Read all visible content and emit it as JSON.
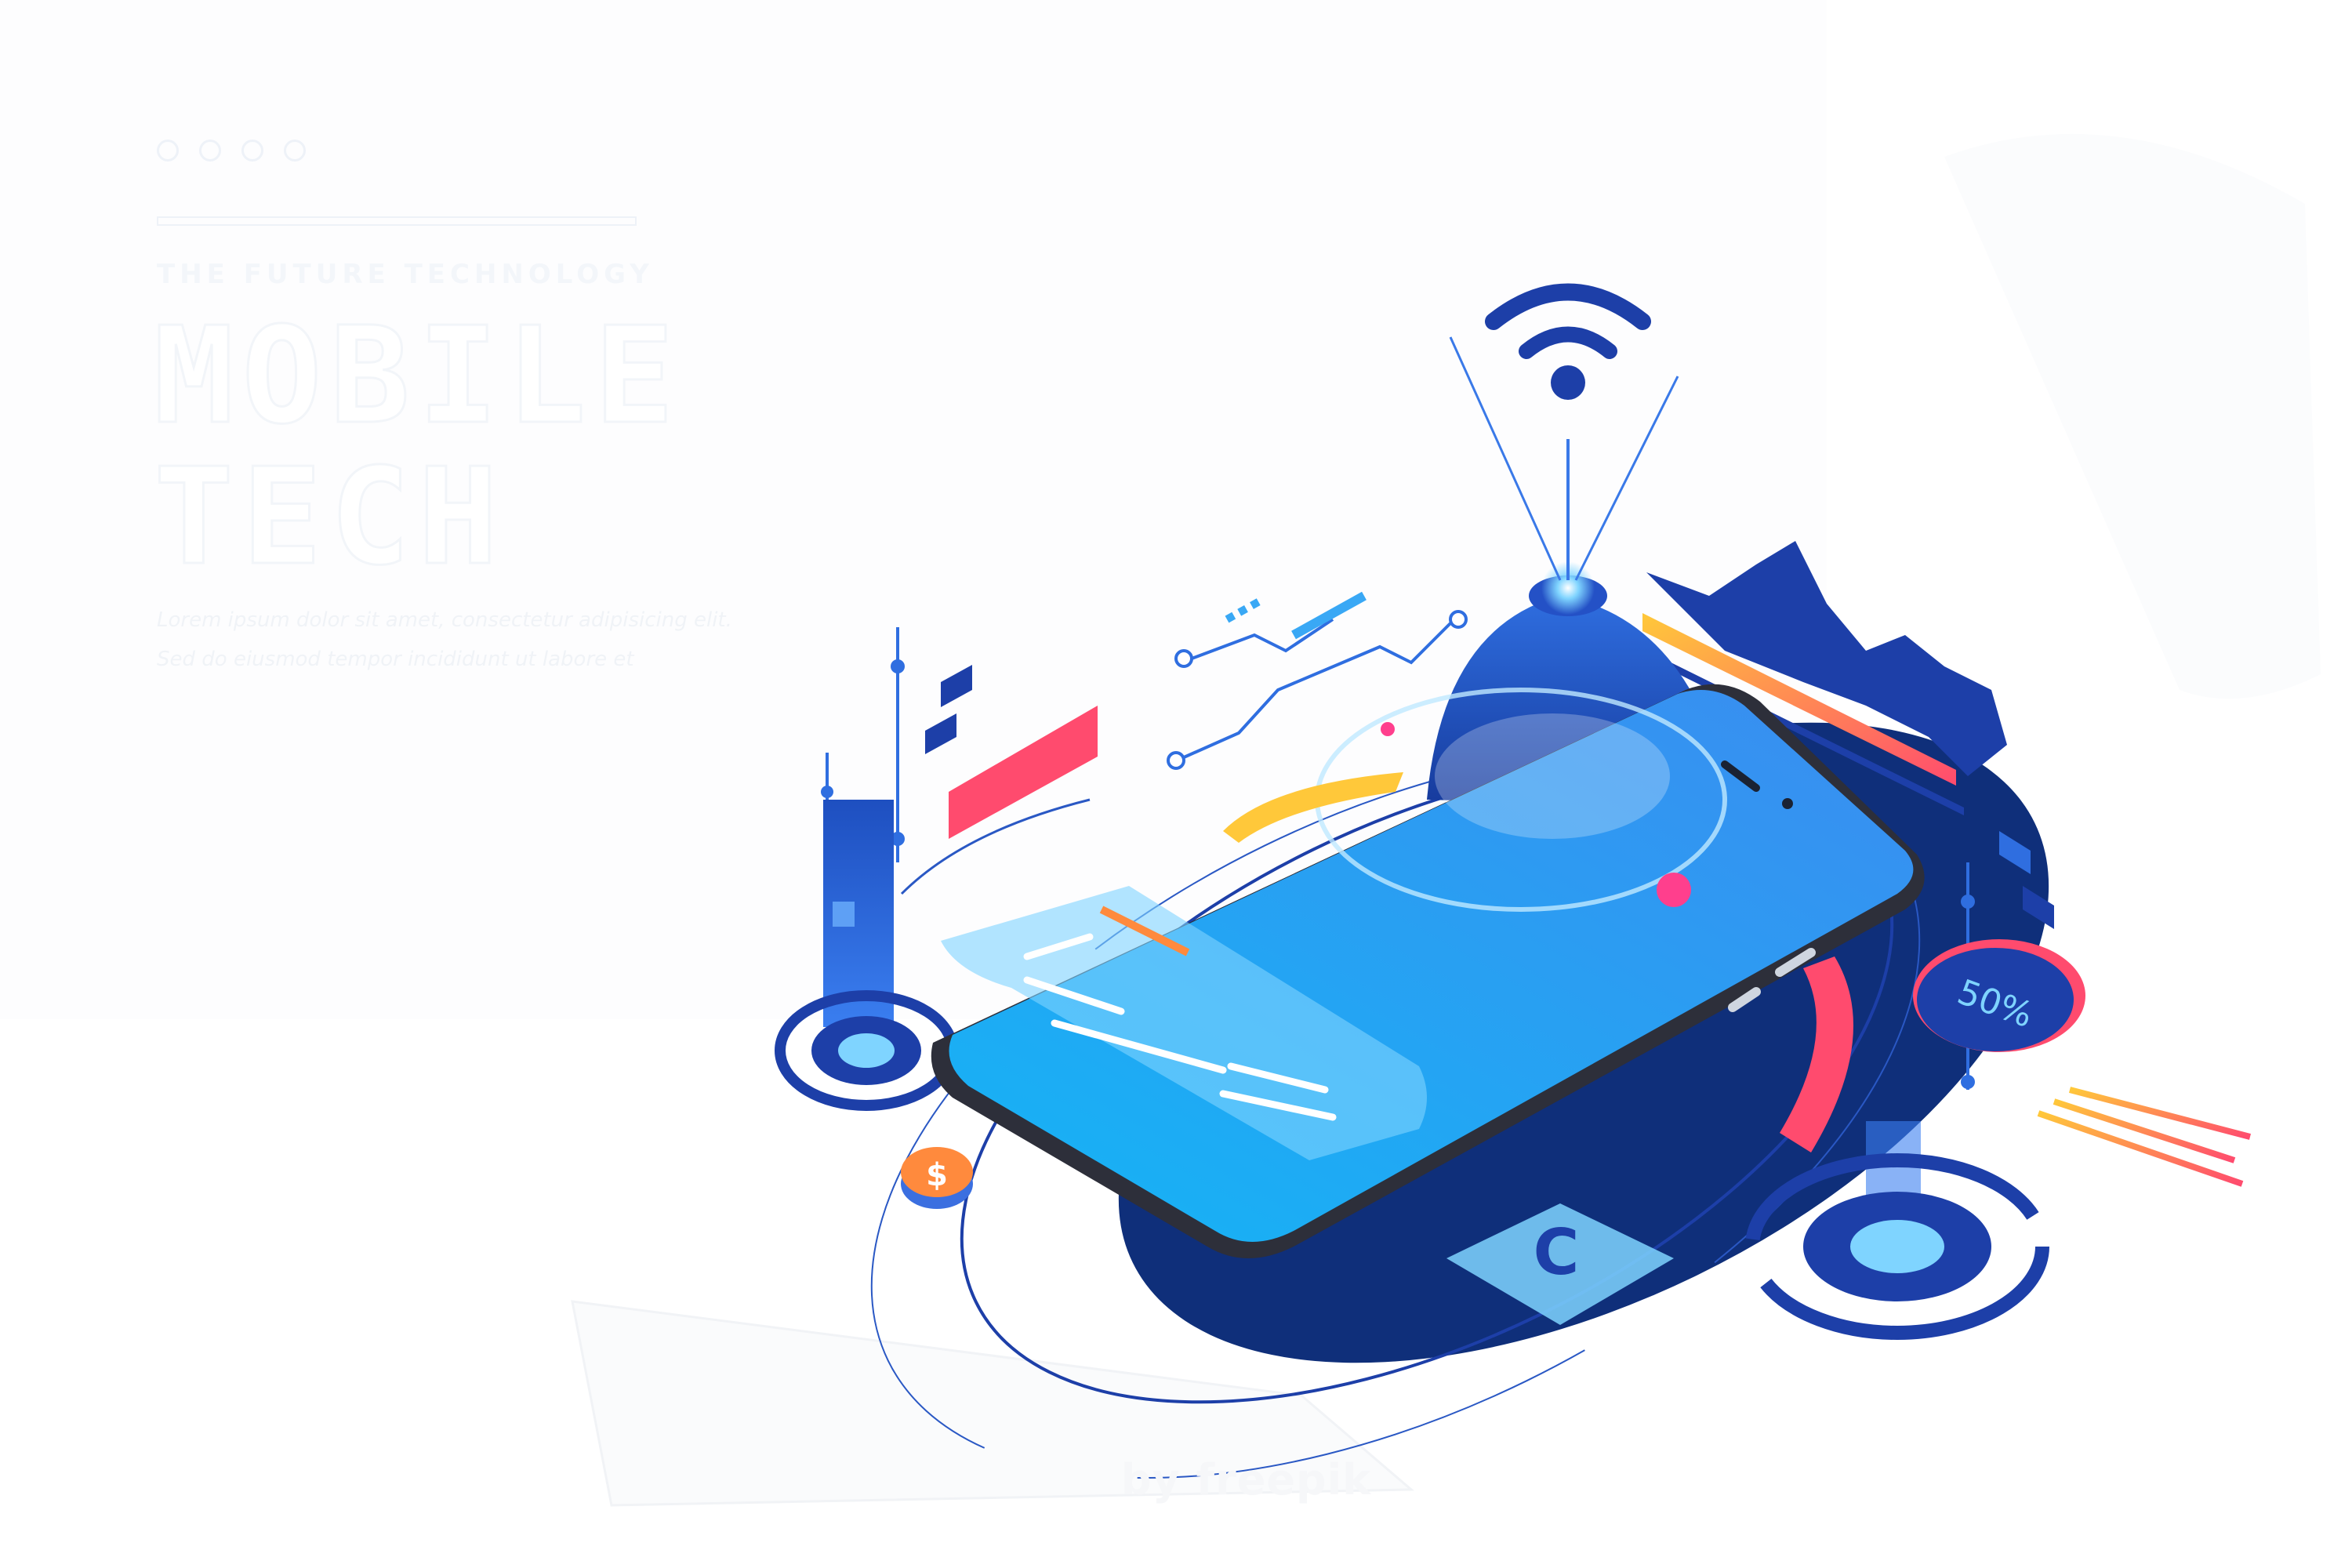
{
  "header": {
    "eyebrow": "THE FUTURE TECHNOLOGY",
    "title_line1": "MOBILE",
    "title_line2": "TECH",
    "body_line1": "Lorem ipsum dolor sit amet, consectetur adipisicing elit.",
    "body_line2": "Sed do eiusmod tempor incididunt ut labore et"
  },
  "illustration": {
    "badge_percent": "50%",
    "currency_symbol": "$",
    "phone_symbol": "C",
    "colors": {
      "primary_blue": "#1d3fa8",
      "deep_navy": "#0f2f7a",
      "screen_blue": "#22a4f0",
      "accent_red": "#ff4b6e",
      "accent_orange": "#ff8a3d",
      "accent_yellow": "#ffc83a",
      "accent_pink": "#ff3f8d"
    },
    "icons": [
      "wifi-icon",
      "circuit-icon",
      "dollar-coin-icon",
      "phone-call-icon",
      "percent-badge-icon",
      "mountain-chart-icon"
    ]
  },
  "footer": {
    "credit": "by freepik"
  }
}
